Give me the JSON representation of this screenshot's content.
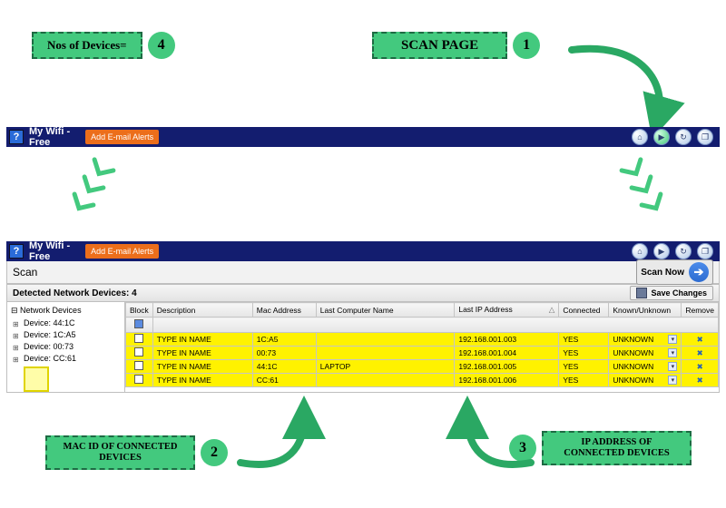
{
  "callouts": {
    "nos_devices": "Nos of Devices=",
    "nos_badge": "4",
    "scan_page": "SCAN PAGE",
    "scan_badge": "1",
    "mac_id": "MAC ID OF CONNECTED DEVICES",
    "mac_badge": "2",
    "ip_addr": "IP ADDRESS OF CONNECTED DEVICES",
    "ip_badge": "3"
  },
  "titlebar": {
    "title": "Who's On My Wifi - Free Edition",
    "alerts_btn": "Add E-mail Alerts",
    "icons": {
      "home": "⌂",
      "play": "▶",
      "loop": "↻",
      "help": "❐"
    }
  },
  "scan": {
    "label": "Scan",
    "scan_now": "Scan Now",
    "detected_label": "Detected Network Devices: 4",
    "save_changes": "Save Changes"
  },
  "tree": {
    "root": "Network Devices",
    "items": [
      "Device: 44:1C",
      "Device: 1C:A5",
      "Device: 00:73",
      "Device: CC:61"
    ]
  },
  "grid": {
    "headers": {
      "block": "Block",
      "desc": "Description",
      "mac": "Mac Address",
      "comp": "Last Computer Name",
      "ip": "Last IP Address",
      "conn": "Connected",
      "ku": "Known/Unknown",
      "rem": "Remove"
    },
    "rows": [
      {
        "desc": "TYPE IN NAME",
        "mac": "1C:A5",
        "comp": "",
        "ip": "192.168.001.003",
        "conn": "YES",
        "ku": "UNKNOWN"
      },
      {
        "desc": "TYPE IN NAME",
        "mac": "00:73",
        "comp": "",
        "ip": "192.168.001.004",
        "conn": "YES",
        "ku": "UNKNOWN"
      },
      {
        "desc": "TYPE IN NAME",
        "mac": "44:1C",
        "comp": "LAPTOP",
        "ip": "192.168.001.005",
        "conn": "YES",
        "ku": "UNKNOWN"
      },
      {
        "desc": "TYPE IN NAME",
        "mac": "CC:61",
        "comp": "",
        "ip": "192.168.001.006",
        "conn": "YES",
        "ku": "UNKNOWN"
      }
    ],
    "remove_glyph": "✖"
  }
}
